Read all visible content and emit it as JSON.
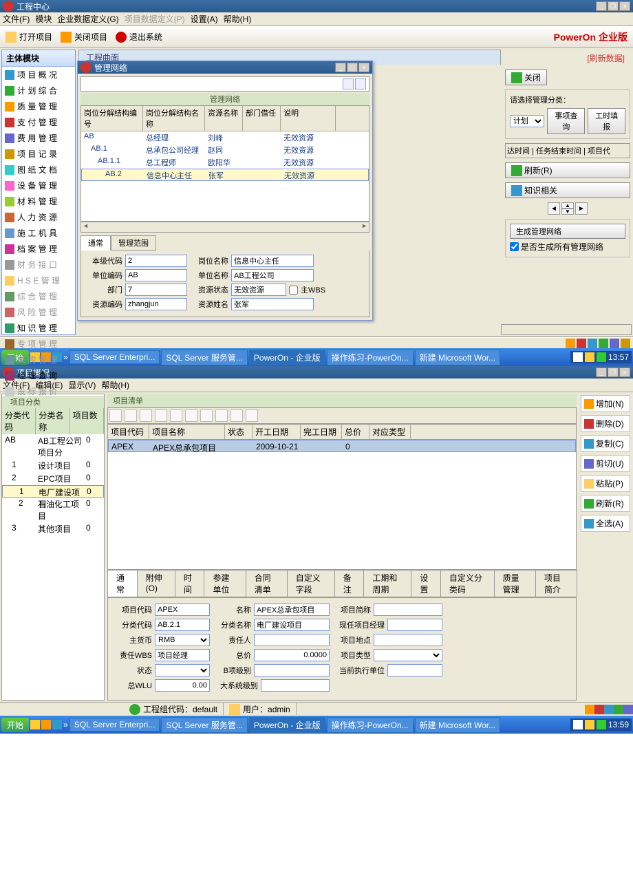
{
  "win1": {
    "title": "工程中心",
    "menus": [
      "文件(F)",
      "模块",
      "企业数据定义(G)",
      "项目数据定义(P)",
      "设置(A)",
      "帮助(H)"
    ],
    "toolbar": {
      "open": "打开项目",
      "close": "关闭项目",
      "exit": "退出系统",
      "brand": "PowerOn 企业版"
    },
    "sidebar_title": "主体模块",
    "sidebar_items": [
      {
        "label": "项 目 概 况",
        "dim": false
      },
      {
        "label": "计 划 综 合",
        "dim": false
      },
      {
        "label": "质 量 管 理",
        "dim": false
      },
      {
        "label": "支 付 管 理",
        "dim": false
      },
      {
        "label": "费 用 管 理",
        "dim": false
      },
      {
        "label": "项 目 记 录",
        "dim": false
      },
      {
        "label": "图 纸 文 档",
        "dim": false
      },
      {
        "label": "设 备 管 理",
        "dim": false
      },
      {
        "label": "材 料 管 理",
        "dim": false
      },
      {
        "label": "人 力 资 源",
        "dim": false
      },
      {
        "label": "施 工 机 具",
        "dim": false
      },
      {
        "label": "档 案 管 理",
        "dim": false
      },
      {
        "label": "财 务 接 口",
        "dim": true
      },
      {
        "label": "H S E 管 理",
        "dim": true
      },
      {
        "label": "综 合 管 理",
        "dim": true
      },
      {
        "label": "风 险 管 理",
        "dim": true
      },
      {
        "label": "知 识 管 理",
        "dim": false
      },
      {
        "label": "专 项 管 理",
        "dim": true
      },
      {
        "label": "采 购 管 理",
        "dim": true
      },
      {
        "label": "经 理 查 询",
        "dim": false
      },
      {
        "label": "投 标 报 价",
        "dim": true
      }
    ],
    "center_label": "工程曲面",
    "dialog": {
      "title": "管理网络",
      "band": "管理网络",
      "cols": [
        "岗位分解结构编号",
        "岗位分解结构名称",
        "资源名称",
        "部门借任",
        "说明"
      ],
      "rows": [
        {
          "c": [
            "AB",
            "总经理",
            "刘峰",
            "",
            "无效资源"
          ],
          "sel": false
        },
        {
          "c": [
            "AB.1",
            "总承包公司经理",
            "赵同",
            "",
            "无效资源"
          ],
          "sel": false
        },
        {
          "c": [
            "AB.1.1",
            "总工程师",
            "欧阳华",
            "",
            "无效资源"
          ],
          "sel": false
        },
        {
          "c": [
            "AB.2",
            "信息中心主任",
            "张军",
            "",
            "无效资源"
          ],
          "sel": true
        }
      ],
      "tabs": [
        "通常",
        "管理范围"
      ],
      "form": {
        "f1l": "本级代码",
        "f1v": "2",
        "f2l": "岗位名称",
        "f2v": "信息中心主任",
        "f3l": "单位编码",
        "f3v": "AB",
        "f4l": "单位名称",
        "f4v": "AB工程公司",
        "f5l": "部门",
        "f5v": "7",
        "f6l": "资源状态",
        "f6v": "无效资源",
        "f6chk": "主WBS",
        "f7l": "资源编码",
        "f7v": "zhangjun",
        "f8l": "资源姓名",
        "f8v": "张军"
      }
    },
    "right": {
      "link": "[刷新数据]",
      "close_btn": "关闭",
      "group_label": "请选择管理分类：",
      "select_val": "计划",
      "btn_query": "事项查询",
      "btn_report": "工时填报",
      "cols": "达时间 | 任务结束时间 | 项目代",
      "refresh_btn": "刷新(R)",
      "related": "知识相关",
      "gen_btn": "生成管理网络",
      "gen_all_chk": "是否生成所有管理网络"
    }
  },
  "taskbar": {
    "start": "开始",
    "items": [
      "SQL Server Enterpri...",
      "SQL Server 服务管...",
      "PowerOn - 企业版",
      "操作练习-PowerOn...",
      "新建 Microsoft Wor..."
    ],
    "time1": "13:57",
    "time2": "13:59"
  },
  "win2": {
    "title": "项目概况",
    "menus": [
      "文件(F)",
      "编辑(E)",
      "显示(V)",
      "帮助(H)"
    ],
    "tree_band": "项目分类",
    "tree_cols": [
      "分类代码",
      "分类名称",
      "项目数"
    ],
    "tree_rows": [
      {
        "c": [
          "AB",
          "AB工程公司项目分",
          "0"
        ],
        "ind": 0
      },
      {
        "c": [
          "1",
          "设计项目",
          "0"
        ],
        "ind": 1
      },
      {
        "c": [
          "2",
          "EPC项目",
          "0"
        ],
        "ind": 1
      },
      {
        "c": [
          "1",
          "电厂建设项目",
          "0"
        ],
        "ind": 2,
        "sel": true
      },
      {
        "c": [
          "2",
          "石油化工项目",
          "0"
        ],
        "ind": 2
      },
      {
        "c": [
          "3",
          "其他项目",
          "0"
        ],
        "ind": 1
      }
    ],
    "list_band": "项目清单",
    "list_cols": [
      "项目代码",
      "项目名称",
      "状态",
      "开工日期",
      "完工日期",
      "总价",
      "对应类型"
    ],
    "list_row": [
      "APEX",
      "APEX总承包项目",
      "",
      "2009-10-21",
      "",
      "0",
      ""
    ],
    "detail_tabs": [
      "通常",
      "附伸(O)",
      "时间",
      "参建单位",
      "合同清单",
      "自定义字段",
      "备注",
      "工期和周期",
      "设置",
      "自定义分类码",
      "质量管理",
      "项目简介"
    ],
    "detail": {
      "r1": {
        "a": "项目代码",
        "av": "APEX",
        "b": "名称",
        "bv": "APEX总承包项目",
        "c": "项目简称",
        "cv": ""
      },
      "r2": {
        "a": "分类代码",
        "av": "AB.2.1",
        "b": "分类名称",
        "bv": "电厂建设项目",
        "c": "现任项目经理",
        "cv": ""
      },
      "r3": {
        "a": "主货币",
        "av": "RMB",
        "b": "责任人",
        "bv": "",
        "c": "项目地点",
        "cv": ""
      },
      "r4": {
        "a": "责任WBS",
        "av": "项目经理",
        "b": "总价",
        "bv": "0.0000",
        "c": "项目类型",
        "cv": ""
      },
      "r5": {
        "a": "状态",
        "av": "",
        "b": "B项级别",
        "bv": "",
        "c": "当前执行单位",
        "cv": ""
      },
      "r6": {
        "a": "总WLU",
        "av": "0.00",
        "b": "大系统级别",
        "bv": ""
      }
    },
    "actions": [
      {
        "l": "增加(N)",
        "c": "#f90"
      },
      {
        "l": "删除(D)",
        "c": "#c33"
      },
      {
        "l": "复制(C)",
        "c": "#39c"
      },
      {
        "l": "剪切(U)",
        "c": "#66c"
      },
      {
        "l": "粘贴(P)",
        "c": "#fc6"
      },
      {
        "l": "刷新(R)",
        "c": "#3a3"
      },
      {
        "l": "全选(A)",
        "c": "#39c"
      }
    ],
    "status": {
      "org": "工程组代码：default",
      "user": "用户：admin"
    }
  }
}
